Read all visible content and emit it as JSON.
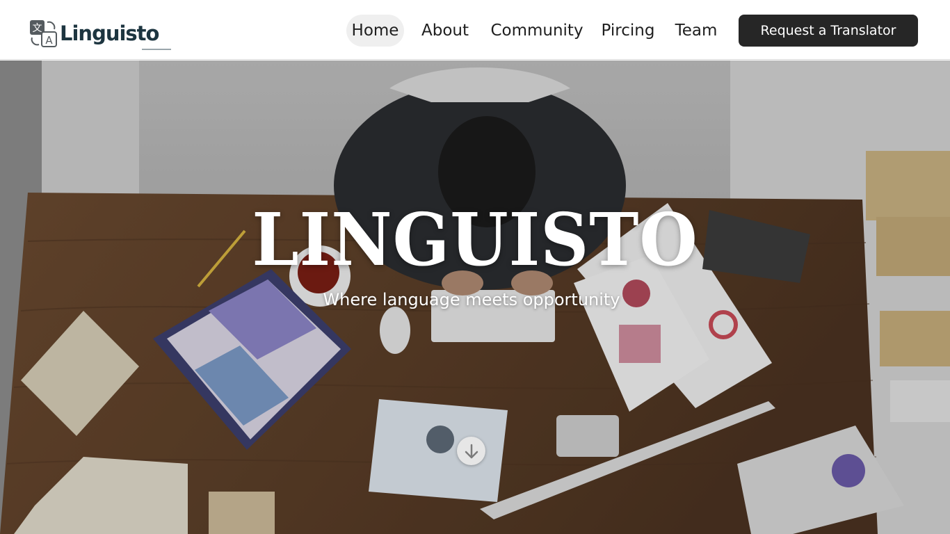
{
  "brand": {
    "name": "Linguisto",
    "logo_icon": "translate-icon",
    "logo_glyph_top": "文",
    "logo_glyph_bottom": "A"
  },
  "nav": {
    "items": [
      {
        "label": "Home",
        "active": true
      },
      {
        "label": "About",
        "active": false
      },
      {
        "label": "Community",
        "active": false
      },
      {
        "label": "Pircing",
        "active": false
      },
      {
        "label": "Team",
        "active": false
      }
    ],
    "cta_label": "Request a Translator"
  },
  "hero": {
    "title": "LINGUISTO",
    "subtitle": "Where language meets opportunity",
    "background": "office-desk-photo",
    "scroll_icon": "arrow-down-icon"
  },
  "colors": {
    "brand_text": "#1d3540",
    "cta_background": "#262626",
    "nav_active_background": "#efefef"
  }
}
